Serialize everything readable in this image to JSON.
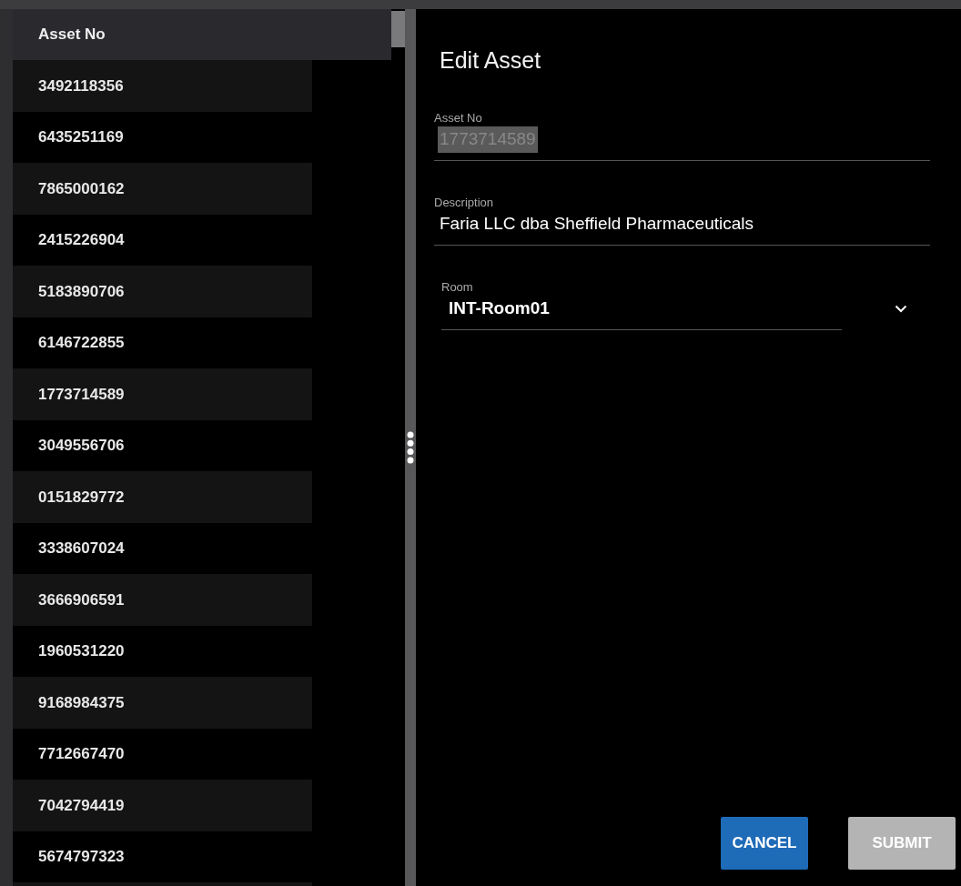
{
  "table": {
    "columns": [
      "Asset No"
    ],
    "rows": [
      "3492118356",
      "6435251169",
      "7865000162",
      "2415226904",
      "5183890706",
      "6146722855",
      "1773714589",
      "3049556706",
      "0151829772",
      "3338607024",
      "3666906591",
      "1960531220",
      "9168984375",
      "7712667470",
      "7042794419",
      "5674797323"
    ]
  },
  "form": {
    "title": "Edit Asset",
    "fields": [
      {
        "kind": "text",
        "label": "Asset No",
        "value": "1773714589",
        "disabled": true
      },
      {
        "kind": "text",
        "label": "Description",
        "value": "Faria LLC dba Sheffield Pharmaceuticals"
      },
      {
        "kind": "select",
        "label": "Room",
        "value": "INT-Room01"
      }
    ]
  },
  "buttons": [
    {
      "label": "CANCEL",
      "disabled": false
    },
    {
      "label": "SUBMIT",
      "disabled": true
    }
  ]
}
